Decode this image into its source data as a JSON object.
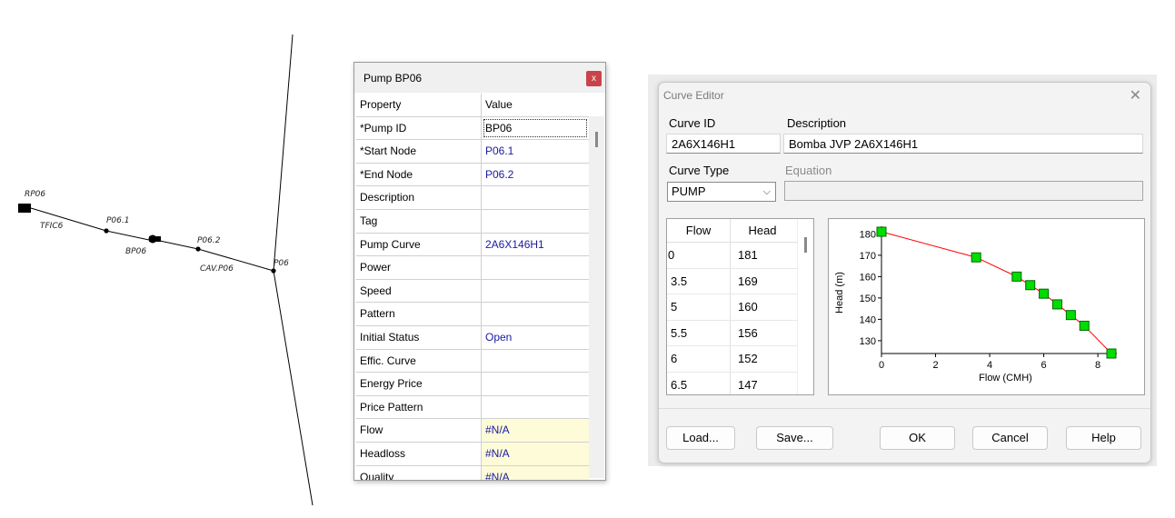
{
  "map": {
    "labels": {
      "reservoir": "RP06",
      "pipe_tfic6": "TFIC6",
      "node_p06_1": "P06.1",
      "pump": "BP06",
      "node_p06_2": "P06.2",
      "valve": "CAV.P06",
      "junction": "P06"
    }
  },
  "property_window": {
    "title": "Pump BP06",
    "close_glyph": "x",
    "columns": [
      "Property",
      "Value"
    ],
    "rows": [
      {
        "property": "*Pump ID",
        "value": "BP06"
      },
      {
        "property": "*Start Node",
        "value": "P06.1"
      },
      {
        "property": "*End Node",
        "value": "P06.2"
      },
      {
        "property": "Description",
        "value": ""
      },
      {
        "property": "Tag",
        "value": ""
      },
      {
        "property": "Pump Curve",
        "value": "2A6X146H1"
      },
      {
        "property": "Power",
        "value": ""
      },
      {
        "property": "Speed",
        "value": ""
      },
      {
        "property": "Pattern",
        "value": ""
      },
      {
        "property": "Initial Status",
        "value": "Open"
      },
      {
        "property": "Effic. Curve",
        "value": ""
      },
      {
        "property": "Energy Price",
        "value": ""
      },
      {
        "property": "Price Pattern",
        "value": ""
      },
      {
        "property": "Flow",
        "value": "#N/A"
      },
      {
        "property": "Headloss",
        "value": "#N/A"
      },
      {
        "property": "Quality",
        "value": "#N/A"
      }
    ]
  },
  "curve_editor": {
    "title": "Curve Editor",
    "close_glyph": "✕",
    "curve_id_label": "Curve ID",
    "curve_id": "2A6X146H1",
    "description_label": "Description",
    "description": "Bomba JVP 2A6X146H1",
    "curve_type_label": "Curve Type",
    "curve_type": "PUMP",
    "equation_label": "Equation",
    "equation": "",
    "table": {
      "headers": [
        "Flow",
        "Head"
      ],
      "rows": [
        {
          "flow": "0",
          "head": "181"
        },
        {
          "flow": "3.5",
          "head": "169"
        },
        {
          "flow": "5",
          "head": "160"
        },
        {
          "flow": "5.5",
          "head": "156"
        },
        {
          "flow": "6",
          "head": "152"
        },
        {
          "flow": "6.5",
          "head": "147"
        }
      ]
    },
    "buttons": {
      "load": "Load...",
      "save": "Save...",
      "ok": "OK",
      "cancel": "Cancel",
      "help": "Help"
    },
    "colors": {
      "curve_line": "#ff0000",
      "marker_fill": "#00dd00",
      "marker_stroke": "#006600"
    }
  },
  "chart_data": {
    "type": "line",
    "title": "",
    "xlabel": "Flow (CMH)",
    "ylabel": "Head (m)",
    "xlim": [
      0,
      8.5
    ],
    "ylim": [
      124,
      181
    ],
    "x_ticks": [
      0,
      2,
      4,
      6,
      8
    ],
    "y_ticks": [
      130,
      140,
      150,
      160,
      170,
      180
    ],
    "grid": false,
    "series": [
      {
        "x": [
          0,
          3.5,
          5,
          5.5,
          6,
          6.5,
          7,
          7.5,
          8.5
        ],
        "y": [
          181,
          169,
          160,
          156,
          152,
          147,
          142,
          137,
          124
        ]
      }
    ]
  }
}
